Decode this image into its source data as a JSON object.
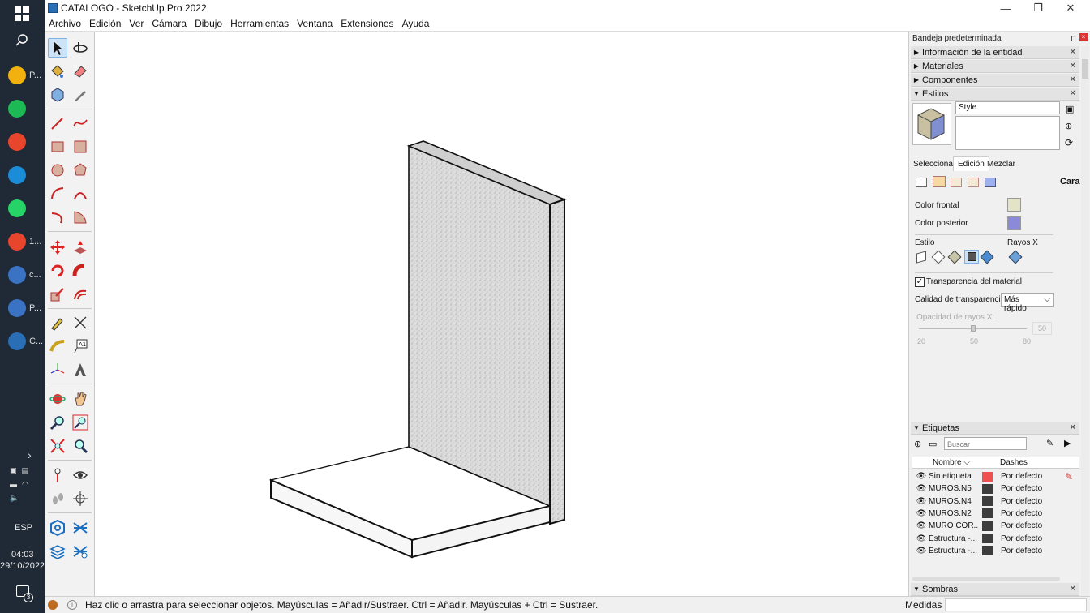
{
  "window": {
    "title": "CATALOGO - SketchUp Pro 2022",
    "minimize": "—",
    "maximize": "❐",
    "close": "✕"
  },
  "menubar": [
    "Archivo",
    "Edición",
    "Ver",
    "Cámara",
    "Dibujo",
    "Herramientas",
    "Ventana",
    "Extensiones",
    "Ayuda"
  ],
  "taskbar": {
    "items": [
      {
        "name": "files-app",
        "label": "P...",
        "color": "#f2b10f"
      },
      {
        "name": "spotify",
        "label": "",
        "color": "#1db954"
      },
      {
        "name": "chrome",
        "label": "",
        "color": "#e7452c"
      },
      {
        "name": "edge",
        "label": "",
        "color": "#1a8cd8"
      },
      {
        "name": "whatsapp",
        "label": "",
        "color": "#25d366"
      },
      {
        "name": "chrome-2",
        "label": "1...",
        "color": "#e7452c"
      },
      {
        "name": "app-c",
        "label": "c...",
        "color": "#3a72c4"
      },
      {
        "name": "app-p",
        "label": "P...",
        "color": "#3a72c4"
      },
      {
        "name": "sketchup",
        "label": "C...",
        "color": "#2a6fb5"
      }
    ],
    "lang": "ESP",
    "time": "04:03",
    "date": "29/10/2022",
    "notif_count": "3"
  },
  "tray": {
    "title": "Bandeja predeterminada",
    "panels": {
      "entity": "Información de la entidad",
      "materials": "Materiales",
      "components": "Componentes",
      "styles": "Estilos"
    },
    "style_name": "Style",
    "tabs": [
      "Seleccionar",
      "Edición",
      "Mezclar"
    ],
    "active_tab": "Edición",
    "section_label": "Cara",
    "front_color_label": "Color frontal",
    "back_color_label": "Color posterior",
    "front_color": "#e3e3c8",
    "back_color": "#8a8ad8",
    "style_label": "Estilo",
    "xray_label": "Rayos X",
    "transparency_label": "Transparencia del material",
    "transparency_checked": true,
    "quality_label": "Calidad de transparencia:",
    "quality_value": "Más rápido",
    "xray_opacity_label": "Opacidad de rayos X:",
    "xray_opacity_value": "50",
    "xray_opacity_fraction": 0.5,
    "ticks": [
      "20",
      "50",
      "80"
    ],
    "tags_title": "Etiquetas",
    "search_placeholder": "Buscar",
    "col_name": "Nombre",
    "col_dashes": "Dashes",
    "tags": [
      {
        "name": "Sin etiqueta",
        "color": "#f05050",
        "dash": "Por defecto"
      },
      {
        "name": "MUROS.N5",
        "color": "#3c3c3c",
        "dash": "Por defecto"
      },
      {
        "name": "MUROS.N4",
        "color": "#3c3c3c",
        "dash": "Por defecto"
      },
      {
        "name": "MUROS.N2",
        "color": "#3c3c3c",
        "dash": "Por defecto"
      },
      {
        "name": "MURO COR...",
        "color": "#3c3c3c",
        "dash": "Por defecto"
      },
      {
        "name": "Estructura -...",
        "color": "#3c3c3c",
        "dash": "Por defecto"
      },
      {
        "name": "Estructura -...",
        "color": "#3c3c3c",
        "dash": "Por defecto"
      }
    ],
    "shadows_title": "Sombras"
  },
  "status": {
    "hint": "Haz clic o arrastra para seleccionar objetos. Mayúsculas = Añadir/Sustraer. Ctrl = Añadir. Mayúsculas + Ctrl = Sustraer.",
    "measures_label": "Medidas"
  }
}
